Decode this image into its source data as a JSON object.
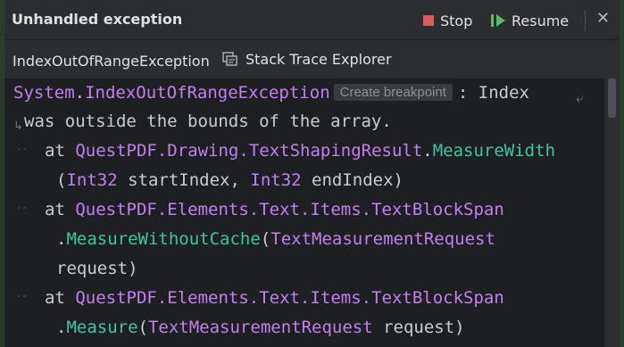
{
  "window": {
    "title": "Unhandled exception",
    "stop_label": "Stop",
    "resume_label": "Resume",
    "close_glyph": "✕"
  },
  "tabs": {
    "exception_tab": "IndexOutOfRangeException",
    "stack_trace_explorer_label": "Stack Trace Explorer"
  },
  "trace": {
    "exception_namespace": "System",
    "exception_class": "IndexOutOfRangeException",
    "create_breakpoint_label": "Create breakpoint",
    "message_part1": ": Index",
    "message_part2": "was outside the bounds of the array.",
    "frames": [
      {
        "at": "at",
        "ns": "QuestPDF.Drawing.",
        "cls": "TextShapingResult",
        "dot": ".",
        "method": "MeasureWidth",
        "open": "(",
        "p1_type": "Int32",
        "p1_name": " startIndex, ",
        "p2_type": "Int32",
        "p2_name": " endIndex)"
      },
      {
        "at": "at",
        "ns": "QuestPDF.Elements.Text.Items.",
        "cls": "TextBlockSpan",
        "dot": ".",
        "method": "MeasureWithoutCache",
        "open": "(",
        "p1_type": "TextMeasurementRequest",
        "p1_name": "request)"
      },
      {
        "at": "at",
        "ns": "QuestPDF.Elements.Text.Items.",
        "cls": "TextBlockSpan",
        "dot": ".",
        "method": "Measure",
        "open": "(",
        "p1_type": "TextMeasurementRequest",
        "p1_name": " request)"
      }
    ]
  },
  "colors": {
    "background": "#1e1f22",
    "panel": "#2b2d30",
    "stop_red": "#db5c5c",
    "resume_green": "#5fb865",
    "keyword_purple": "#c081ee",
    "method_teal": "#3fc5a6"
  }
}
